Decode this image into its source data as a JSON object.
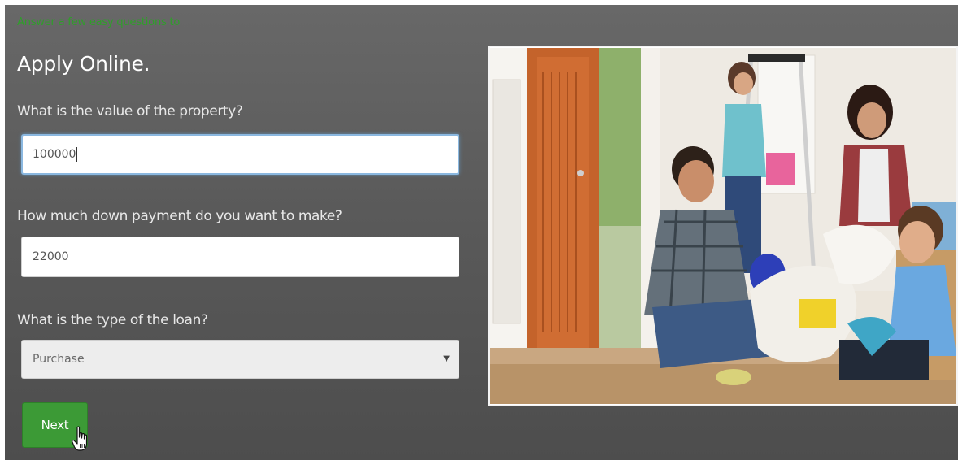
{
  "form": {
    "tagline": "Answer a few easy questions to",
    "title": "Apply Online.",
    "questions": [
      {
        "label": "What is the value of the property?",
        "value": "100000"
      },
      {
        "label": "How much down payment do you want to make?",
        "value": "22000"
      },
      {
        "label": "What is the type of the loan?",
        "value": "Purchase"
      }
    ],
    "next_label": "Next",
    "accent_color": "#3c9a36"
  },
  "image": {
    "subject": "family-unpacking-photo"
  },
  "icons": {
    "select_arrow": "dropdown-arrow-icon",
    "cursor": "hand-pointer-icon"
  }
}
